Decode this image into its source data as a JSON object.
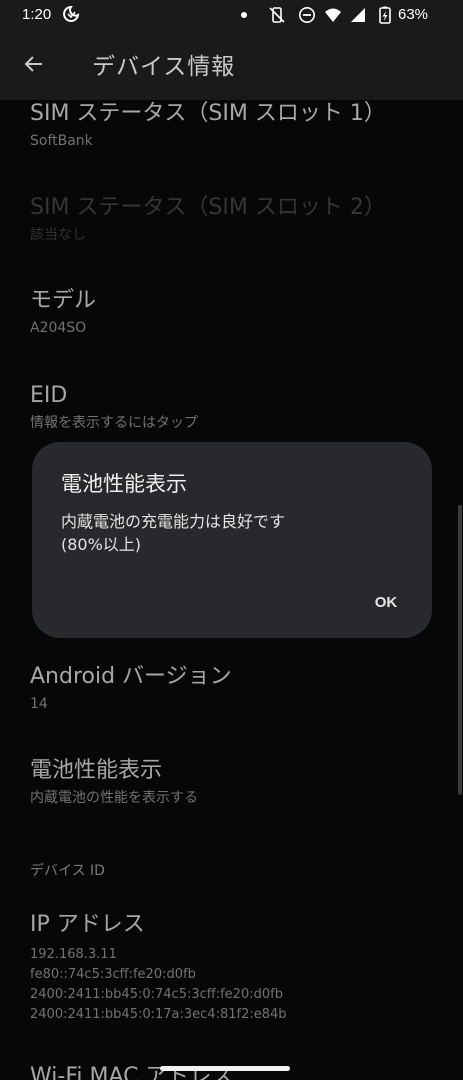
{
  "status_bar": {
    "time": "1:20",
    "battery_percent": "63%",
    "icons": [
      "do-not-disturb-moon-icon",
      "notification-dot",
      "vibrate-off-icon",
      "dnd-minus-icon",
      "wifi-icon",
      "signal-icon",
      "battery-charging-icon"
    ]
  },
  "app_bar": {
    "title": "デバイス情報"
  },
  "items": {
    "sim1": {
      "title": "SIM ステータス（SIM スロット 1）",
      "summary": "SoftBank"
    },
    "sim2": {
      "title": "SIM ステータス（SIM スロット 2）",
      "summary": "該当なし"
    },
    "model": {
      "title": "モデル",
      "summary": "A204SO"
    },
    "eid": {
      "title": "EID",
      "summary": "情報を表示するにはタップ"
    },
    "android_version": {
      "title": "Android バージョン",
      "summary": "14"
    },
    "battery": {
      "title": "電池性能表示",
      "summary": "内蔵電池の性能を表示する"
    },
    "device_id_header": "デバイス ID",
    "ip": {
      "title": "IP アドレス",
      "lines": [
        "192.168.3.11",
        "fe80::74c5:3cff:fe20:d0fb",
        "2400:2411:bb45:0:74c5:3cff:fe20:d0fb",
        "2400:2411:bb45:0:17a:3ec4:81f2:e84b"
      ]
    },
    "wifi_mac": {
      "title": "Wi-Fi MAC アドレス"
    }
  },
  "dialog": {
    "title": "電池性能表示",
    "message_line1": "内蔵電池の充電能力は良好です",
    "message_line2": "(80%以上)",
    "ok_label": "OK"
  },
  "colors": {
    "background": "#0a0a0a",
    "bar": "#1a1a1a",
    "dialog": "#28292c"
  }
}
